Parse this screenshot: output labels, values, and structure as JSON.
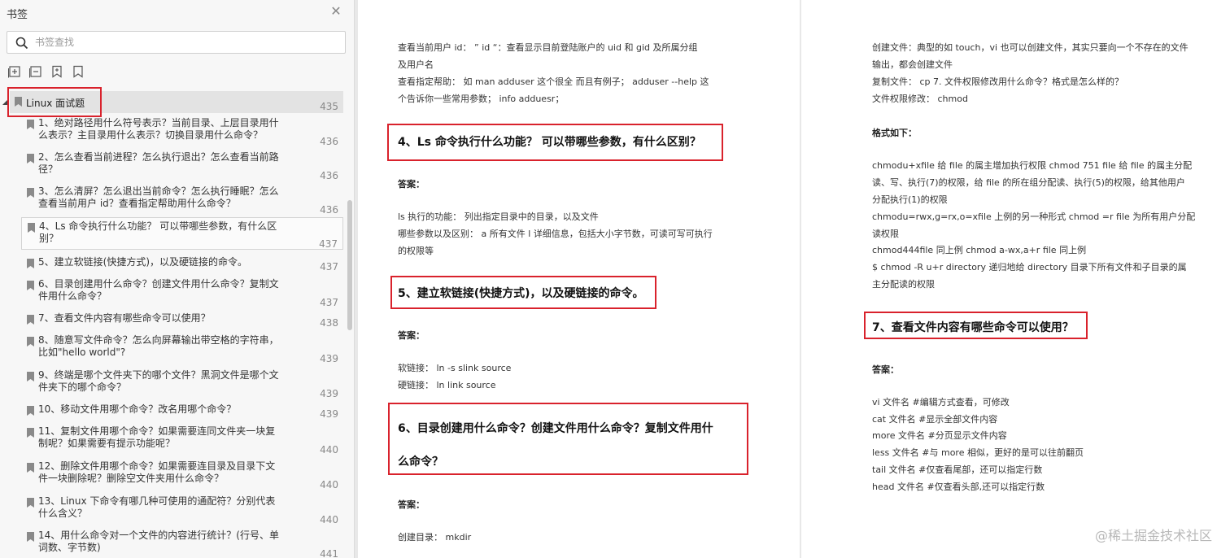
{
  "sidebar": {
    "title": "书签",
    "search_placeholder": "书签查找",
    "root": {
      "label": "Linux 面试题",
      "page": "435"
    },
    "items": [
      {
        "label": "1、绝对路径用什么符号表示？当前目录、上层目录用什么表示？主目录用什么表示？切换目录用什么命令？",
        "page": "436"
      },
      {
        "label": "2、怎么查看当前进程？怎么执行退出？怎么查看当前路径？",
        "page": "436"
      },
      {
        "label": "3、怎么清屏？怎么退出当前命令？怎么执行睡眠？怎么查看当前用户 id？查看指定帮助用什么命令？",
        "page": "436"
      },
      {
        "label": "4、Ls 命令执行什么功能？ 可以带哪些参数，有什么区别？",
        "page": "437"
      },
      {
        "label": "5、建立软链接(快捷方式)，以及硬链接的命令。",
        "page": "437"
      },
      {
        "label": "6、目录创建用什么命令？创建文件用什么命令？复制文件用什么命令？",
        "page": "437"
      },
      {
        "label": "7、查看文件内容有哪些命令可以使用？",
        "page": "438"
      },
      {
        "label": "8、随意写文件命令？怎么向屏幕输出带空格的字符串，比如\"hello world\"?",
        "page": "439"
      },
      {
        "label": "9、终端是哪个文件夹下的哪个文件？黑洞文件是哪个文件夹下的哪个命令？",
        "page": "439"
      },
      {
        "label": "10、移动文件用哪个命令？改名用哪个命令？",
        "page": "439"
      },
      {
        "label": "11、复制文件用哪个命令？如果需要连同文件夹一块复制呢？如果需要有提示功能呢？",
        "page": "440"
      },
      {
        "label": "12、删除文件用哪个命令？如果需要连目录及目录下文件一块删除呢？删除空文件夹用什么命令？",
        "page": "440"
      },
      {
        "label": "13、Linux 下命令有哪几种可使用的通配符？分别代表什么含义？",
        "page": "440"
      },
      {
        "label": "14、用什么命令对一个文件的内容进行统计？(行号、单词数、字节数)",
        "page": "441"
      }
    ]
  },
  "left_page": {
    "intro_lines": [
      "查看当前用户  id：  ” id “：查看显示目前登陆账户的  uid  和  gid  及所属分组",
      "及用户名",
      "查看指定帮助：  如  man adduser  这个很全  而且有例子；   adduser --help  这",
      "个告诉你一些常用参数；   info adduesr；"
    ],
    "q4_title": "4、Ls  命令执行什么功能？  可以带哪些参数，有什么区别？",
    "q4_answer_label": "答案：",
    "q4_lines": [
      "ls  执行的功能：   列出指定目录中的目录，以及文件",
      "哪些参数以及区别：   a  所有文件 l  详细信息，包括大小字节数，可读可写可执行",
      "的权限等"
    ],
    "q5_title": "5、建立软链接(快捷方式)，以及硬链接的命令。",
    "q5_answer_label": "答案：",
    "q5_lines": [
      "软链接：   ln -s slink source",
      "硬链接：   ln link source"
    ],
    "q6_title_line1": "6、目录创建用什么命令？创建文件用什么命令？复制文件用什",
    "q6_title_line2": "么命令？",
    "q6_answer_label": "答案：",
    "q6_lines": [
      "创建目录：   mkdir"
    ]
  },
  "right_page": {
    "intro_lines": [
      "创建文件：典型的如   touch，vi  也可以创建文件，其实只要向一个不存在的文件",
      "输出，都会创建文件",
      "复制文件：   cp 7.  文件权限修改用什么命令？格式是怎么样的？",
      "文件权限修改：   chmod"
    ],
    "format_label": "格式如下：",
    "chmod_lines": [
      "chmodu+xfile 给 file 的属主增加执行权限  chmod 751 file  给   file  的属主分配",
      "读、写、执行(7)的权限，给  file  的所在组分配读、执行(5)的权限，给其他用户",
      "分配执行(1)的权限",
      "chmodu=rwx,g=rx,o=xfile 上例的另一种形式  chmod =r file  为所有用户分配",
      "读权限",
      "chmod444file 同上例  chmod a-wx,a+r file 同上例",
      "$ chmod -R u+r directory  递归地给   directory  目录下所有文件和子目录的属",
      "主分配读的权限"
    ],
    "q7_title": "7、查看文件内容有哪些命令可以使用？",
    "q7_answer_label": "答案：",
    "q7_lines": [
      "vi  文件名  #编辑方式查看，可修改",
      "cat  文件名  #显示全部文件内容",
      "more  文件名  #分页显示文件内容",
      "less  文件名  #与   more  相似，更好的是可以往前翻页",
      "tail  文件名  #仅查看尾部，还可以指定行数",
      "head  文件名  #仅查看头部,还可以指定行数"
    ]
  },
  "watermark": "@稀土掘金技术社区"
}
